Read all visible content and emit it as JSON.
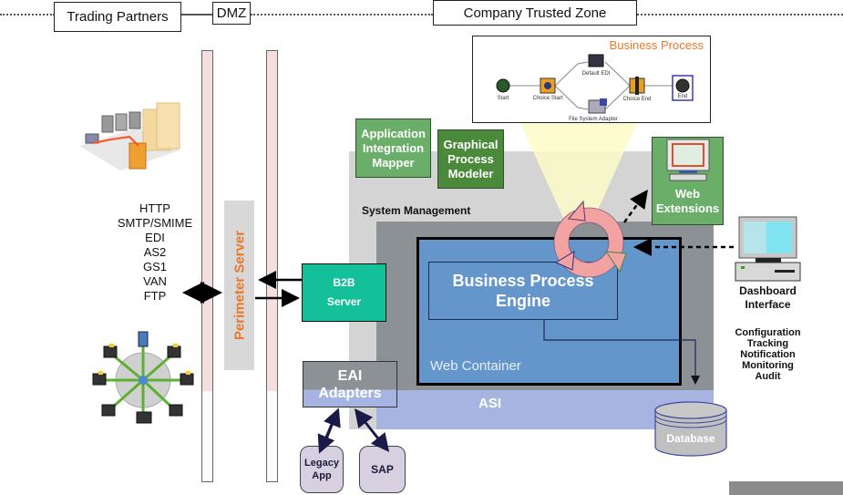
{
  "zones": {
    "trading_partners": "Trading Partners",
    "dmz": "DMZ",
    "company_trusted_zone": "Company Trusted Zone"
  },
  "business_process": {
    "title": "Business Process",
    "nodes": [
      "Start",
      "Choice Start",
      "Default EDI",
      "File System Adapter",
      "Choice End",
      "End"
    ]
  },
  "components": {
    "app_integration_mapper": "Application Integration Mapper",
    "graphical_process_modeler": "Graphical Process Modeler",
    "system_management": "System Management",
    "web_extensions": "Web Extensions",
    "perimeter_server": "Perimeter Server",
    "b2b_server": [
      "B2B",
      "Server"
    ],
    "bpe": [
      "Business Process",
      "Engine"
    ],
    "web_container": "Web Container",
    "asi": "ASI",
    "eai_adapters": [
      "EAI",
      "Adapters"
    ],
    "legacy_app": [
      "Legacy",
      "App"
    ],
    "sap": "SAP",
    "database": "Database",
    "dashboard_interface": [
      "Dashboard",
      "Interface"
    ]
  },
  "protocols": [
    "HTTP",
    "SMTP/SMIME",
    "EDI",
    "AS2",
    "GS1",
    "VAN",
    "FTP"
  ],
  "dashboard_functions": [
    "Configuration",
    "Tracking",
    "Notification",
    "Monitoring",
    "Audit"
  ],
  "colors": {
    "perimeter_text": "#e8782a",
    "b2b_green": "#13c09a",
    "web_container_blue": "#6496cb",
    "asi_band": "#a5b4e0",
    "bp_title_orange": "#e8782a"
  }
}
